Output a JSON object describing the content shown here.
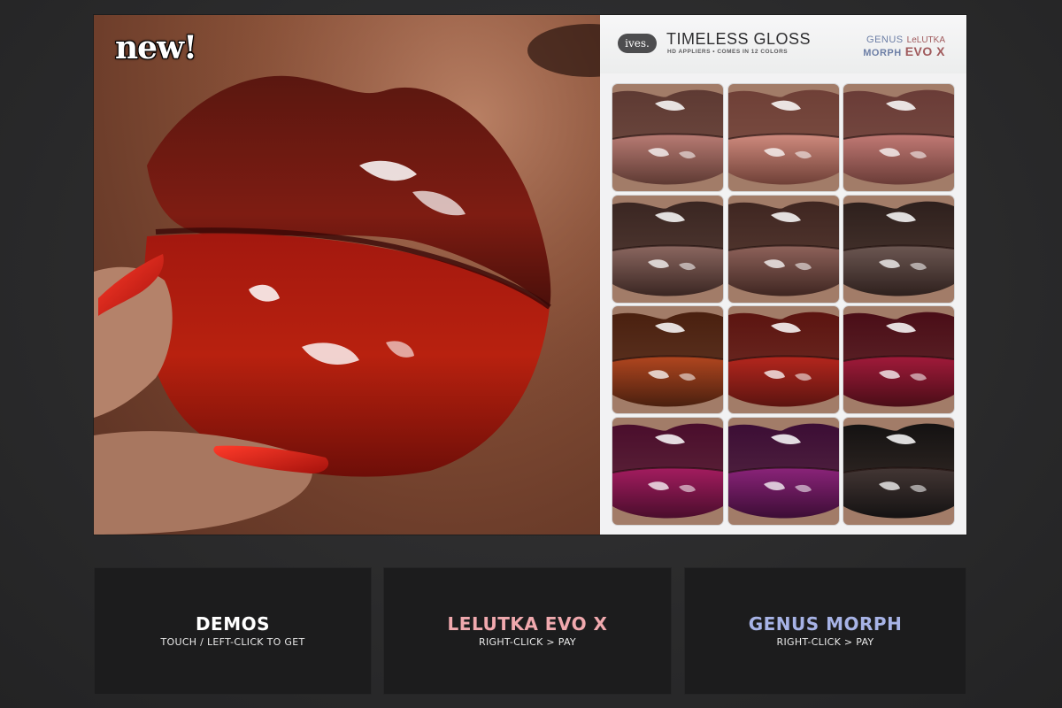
{
  "poster": {
    "badge": "new!",
    "brand": "ives.",
    "product_title": "TIMELESS GLOSS",
    "product_subtitle": "HD APPLIERS  •  COMES IN 12 COLORS",
    "compat_genus": "GENUS",
    "compat_lelutka": "LeLUTKA",
    "compat_morph": "MORPH",
    "compat_evox": "EVO X"
  },
  "swatches": [
    {
      "name": "swatch-1",
      "top": "#5e3a33",
      "bottom": "#b97c74"
    },
    {
      "name": "swatch-2",
      "top": "#6f4037",
      "bottom": "#d08b7e"
    },
    {
      "name": "swatch-3",
      "top": "#6a3c37",
      "bottom": "#c27a75"
    },
    {
      "name": "swatch-4",
      "top": "#3a2622",
      "bottom": "#8b6760"
    },
    {
      "name": "swatch-5",
      "top": "#3f2621",
      "bottom": "#8e625a"
    },
    {
      "name": "swatch-6",
      "top": "#2e201d",
      "bottom": "#6c5752"
    },
    {
      "name": "swatch-7",
      "top": "#4a200f",
      "bottom": "#b1461f"
    },
    {
      "name": "swatch-8",
      "top": "#5c1410",
      "bottom": "#b4261d"
    },
    {
      "name": "swatch-9",
      "top": "#4a0d17",
      "bottom": "#a11a3a"
    },
    {
      "name": "swatch-10",
      "top": "#4a0d2c",
      "bottom": "#a31c5f"
    },
    {
      "name": "swatch-11",
      "top": "#3c0d35",
      "bottom": "#8a2379"
    },
    {
      "name": "swatch-12",
      "top": "#141212",
      "bottom": "#433634"
    }
  ],
  "buttons": [
    {
      "title": "DEMOS",
      "hint": "TOUCH / LEFT-CLICK TO GET",
      "color": "#ffffff"
    },
    {
      "title": "LELUTKA EVO X",
      "hint": "RIGHT-CLICK > PAY",
      "color": "#f0a9ae"
    },
    {
      "title": "GENUS MORPH",
      "hint": "RIGHT-CLICK > PAY",
      "color": "#a7b3e6"
    }
  ]
}
